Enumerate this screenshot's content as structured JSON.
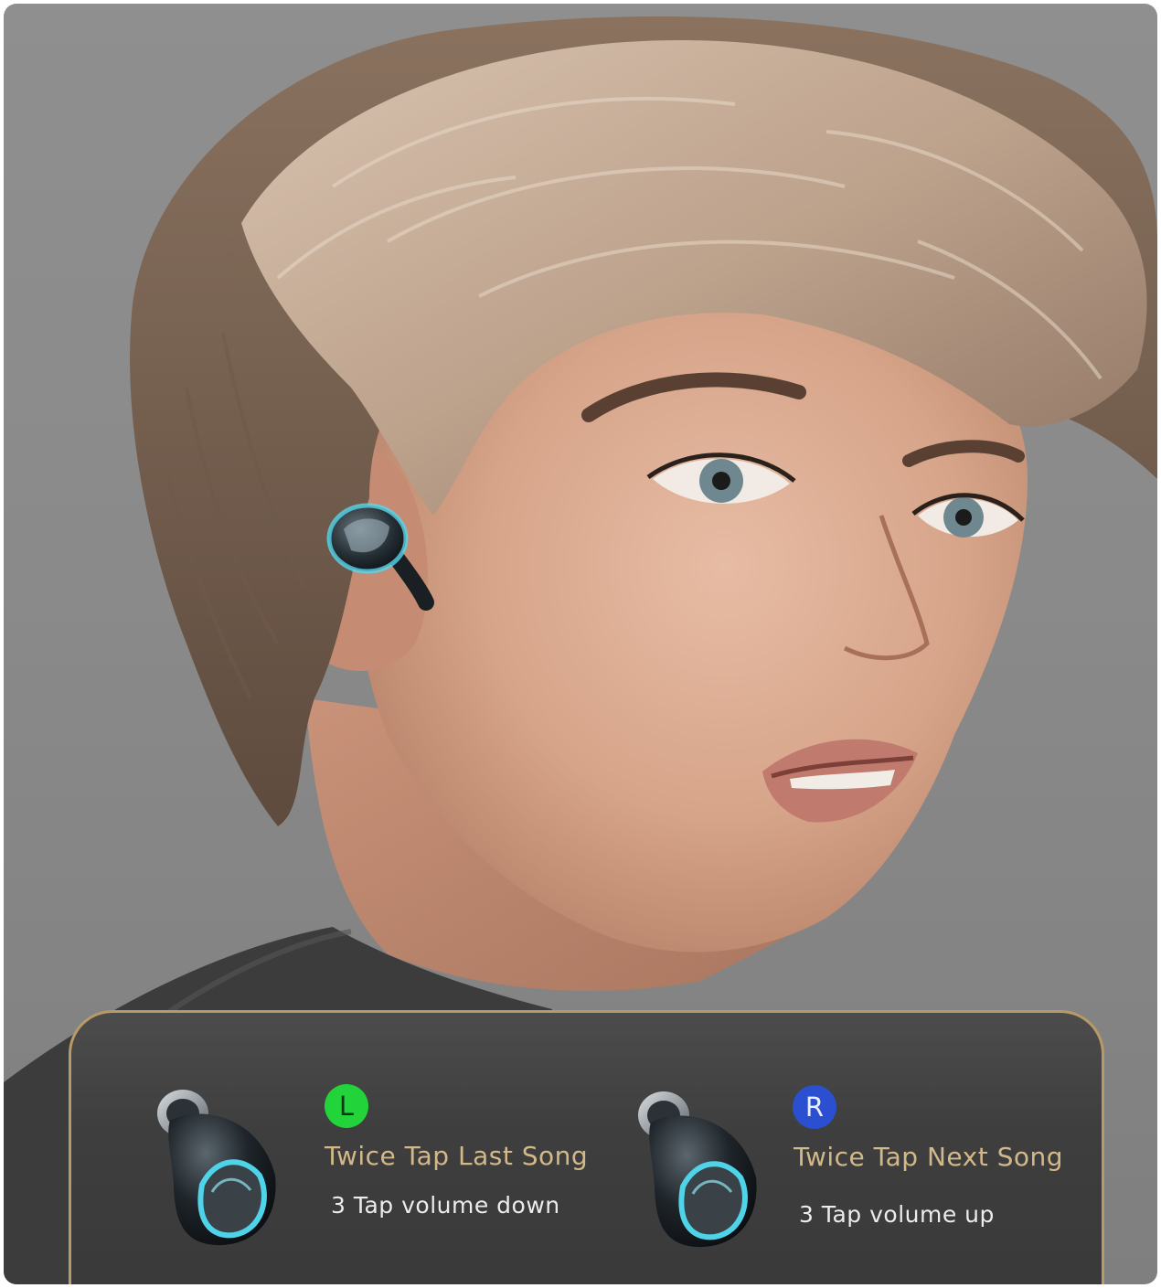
{
  "left": {
    "badge": "L",
    "title": "Twice Tap Last Song",
    "subtitle": "3 Tap volume down"
  },
  "right": {
    "badge": "R",
    "title": "Twice Tap Next Song",
    "subtitle": "3 Tap volume up"
  },
  "colors": {
    "badge_left": "#22d43a",
    "badge_right": "#2a4fd0",
    "title_text": "#d3b98a",
    "panel_border": "#b79a68",
    "earbud_glow": "#57d6ea"
  },
  "icons": {
    "earbud_left": "earbud-icon",
    "earbud_right": "earbud-icon"
  }
}
